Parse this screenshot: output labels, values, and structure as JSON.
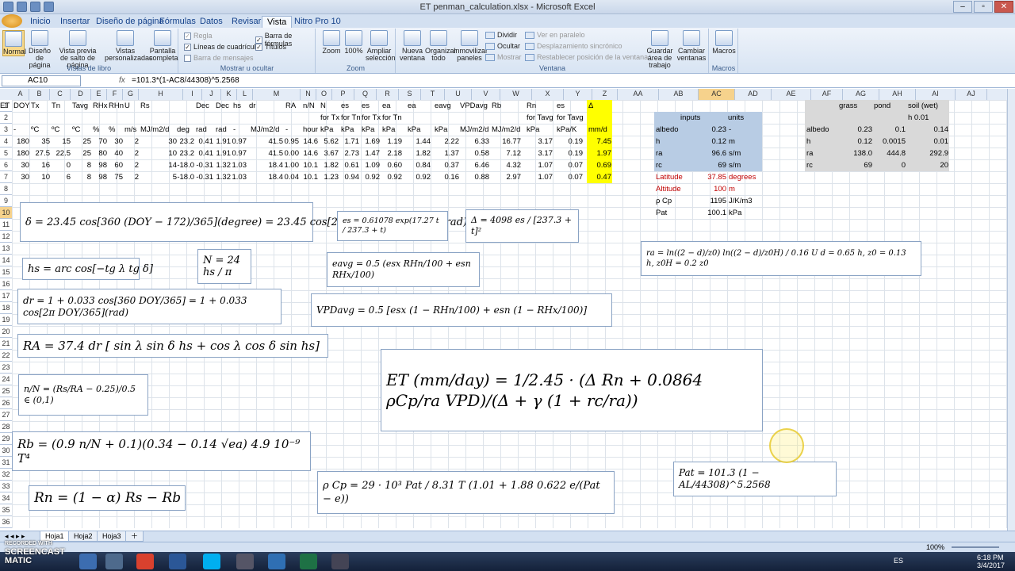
{
  "window": {
    "title": "ET penman_calculation.xlsx - Microsoft Excel"
  },
  "tabs": [
    "Inicio",
    "Insertar",
    "Diseño de página",
    "Fórmulas",
    "Datos",
    "Revisar",
    "Vista",
    "Nitro Pro 10"
  ],
  "ribbon": {
    "views": {
      "label": "Vistas de libro",
      "buttons": [
        "Normal",
        "Diseño de página",
        "Vista previa de salto de página",
        "Vistas personalizadas",
        "Pantalla completa"
      ]
    },
    "show": {
      "label": "Mostrar u ocultar",
      "items": [
        "Regla",
        "Barra de fórmulas",
        "Líneas de cuadrícula",
        "Títulos",
        "Barra de mensajes"
      ]
    },
    "zoom": {
      "label": "Zoom",
      "buttons": [
        "Zoom",
        "100%",
        "Ampliar selección"
      ]
    },
    "window": {
      "label": "Ventana",
      "buttons": [
        "Nueva ventana",
        "Organizar todo",
        "Inmovilizar paneles"
      ],
      "small": [
        "Dividir",
        "Ocultar",
        "Mostrar",
        "Ver en paralelo",
        "Desplazamiento sincrónico",
        "Restablecer posición de la ventana"
      ],
      "more": [
        "Guardar área de trabajo",
        "Cambiar ventanas"
      ]
    },
    "macros": {
      "label": "Macros",
      "button": "Macros"
    }
  },
  "formula_bar": {
    "name": "AC10",
    "fx": "fx",
    "formula": "=101.3*(1-AC8/44308)^5.2568"
  },
  "columns": [
    "A",
    "B",
    "C",
    "D",
    "E",
    "F",
    "G",
    "H",
    "I",
    "J",
    "K",
    "L",
    "M",
    "N",
    "O",
    "P",
    "Q",
    "R",
    "S",
    "T",
    "U",
    "V",
    "W",
    "X",
    "Y",
    "Z",
    "AA",
    "AB",
    "AC",
    "AD",
    "AE",
    "AF",
    "AG",
    "AH",
    "AI",
    "AJ"
  ],
  "rows": [
    "1",
    "2",
    "3",
    "4",
    "5",
    "6",
    "7",
    "8",
    "9",
    "10",
    "11",
    "12",
    "13",
    "14",
    "15",
    "16",
    "17",
    "18",
    "19",
    "20",
    "21",
    "22",
    "23",
    "24",
    "25",
    "26",
    "27",
    "28",
    "29",
    "30",
    "31",
    "32",
    "33",
    "34",
    "35",
    "36",
    "37",
    "38"
  ],
  "table": {
    "header1": [
      "DOY",
      "Tx",
      "Tn",
      "Tavg",
      "RHx",
      "RHn",
      "U",
      "Rs",
      "",
      "Dec",
      "Dec",
      "hs",
      "dr",
      "",
      "RA",
      "n/N",
      "N",
      "es",
      "es",
      "ea",
      "ea",
      "eavg",
      "VPDavg",
      "Rb",
      "Rn",
      "es",
      "Δ",
      "ET"
    ],
    "header2": [
      "for Tx",
      "for Tn",
      "for Tx",
      "for Tn",
      "for Tavg",
      "for Tavg"
    ],
    "header3": [
      "-",
      "ºC",
      "ºC",
      "ºC",
      "%",
      "%",
      "m/s",
      "MJ/m2/d",
      "deg",
      "rad",
      "rad",
      "-",
      "",
      "MJ/m2/d",
      "-",
      "hour",
      "kPa",
      "kPa",
      "kPa",
      "kPa",
      "kPa",
      "kPa",
      "MJ/m2/d",
      "MJ/m2/d",
      "kPa",
      "kPa/K",
      "mm/d"
    ],
    "rows": [
      [
        "180",
        "35",
        "15",
        "25",
        "70",
        "30",
        "2",
        "30",
        "23.2",
        "0.41",
        "1.91",
        "0.97",
        "",
        "41.5",
        "0.95",
        "14.6",
        "5.62",
        "1.71",
        "1.69",
        "1.19",
        "1.44",
        "2.22",
        "6.33",
        "16.77",
        "3.17",
        "0.19",
        "7.45"
      ],
      [
        "180",
        "27.5",
        "22.5",
        "25",
        "80",
        "40",
        "2",
        "10",
        "23.2",
        "0.41",
        "1.91",
        "0.97",
        "",
        "41.5",
        "0.00",
        "14.6",
        "3.67",
        "2.73",
        "1.47",
        "2.18",
        "1.82",
        "1.37",
        "0.58",
        "7.12",
        "3.17",
        "0.19",
        "1.97"
      ],
      [
        "30",
        "16",
        "0",
        "8",
        "98",
        "60",
        "2",
        "14",
        "-18.0",
        "-0.31",
        "1.32",
        "1.03",
        "",
        "18.4",
        "1.00",
        "10.1",
        "1.82",
        "0.61",
        "1.09",
        "0.60",
        "0.84",
        "0.37",
        "6.46",
        "4.32",
        "1.07",
        "0.07",
        "0.69"
      ],
      [
        "30",
        "10",
        "6",
        "8",
        "98",
        "75",
        "2",
        "5",
        "-18.0",
        "-0.31",
        "1.32",
        "1.03",
        "",
        "18.4",
        "0.04",
        "10.1",
        "1.23",
        "0.94",
        "0.92",
        "0.92",
        "0.92",
        "0.16",
        "0.88",
        "2.97",
        "1.07",
        "0.07",
        "0.47"
      ]
    ]
  },
  "inputs": {
    "title": "inputs",
    "units_title": "units",
    "rows": [
      {
        "label": "albedo",
        "value": "0.23",
        "unit": "-"
      },
      {
        "label": "h",
        "value": "0.12",
        "unit": "m"
      },
      {
        "label": "ra",
        "value": "96.6",
        "unit": "s/m"
      },
      {
        "label": "rc",
        "value": "69",
        "unit": "s/m"
      },
      {
        "label": "Latitude",
        "value": "37.85",
        "unit": "degrees"
      },
      {
        "label": "Altitude",
        "value": "100",
        "unit": "m"
      },
      {
        "label": "ρ Cp",
        "value": "1195",
        "unit": "J/K/m3"
      },
      {
        "label": "Pat",
        "value": "100.1",
        "unit": "kPa"
      }
    ]
  },
  "surfaces": {
    "headers": [
      "grass",
      "pond",
      "soil (wet)"
    ],
    "sub": "h 0.01",
    "rows": [
      {
        "label": "albedo",
        "values": [
          "0.23",
          "0.1",
          "0.14"
        ]
      },
      {
        "label": "h",
        "values": [
          "0.12",
          "0.0015",
          "0.01"
        ]
      },
      {
        "label": "ra",
        "values": [
          "138.0",
          "444.8",
          "292.9"
        ]
      },
      {
        "label": "rc",
        "values": [
          "69",
          "0",
          "20"
        ]
      }
    ]
  },
  "equations": {
    "dec": "δ = 23.45 cos[360 (DOY − 172)/365](degree) = 23.45 cos[2π (DOY − 172)/365](rad)",
    "es": "es = 0.61078 exp(17.27 t / 237.3 + t)",
    "delta": "Δ = 4098 es / [237.3 + t]²",
    "hs": "hs = arc cos[−tg λ tg δ]",
    "N": "N = 24 hs / π",
    "eavg": "eavg = 0.5 (esx RHn/100 + esn RHx/100)",
    "dr": "dr = 1 + 0.033 cos[360 DOY/365] = 1 + 0.033 cos[2π DOY/365](rad)",
    "vpd": "VPDavg = 0.5 [esx (1 − RHn/100) + esn (1 − RHx/100)]",
    "RA": "RA = 37.4 dr [ sin λ sin δ hs + cos λ cos δ sin hs]",
    "nN": "n/N = (Rs/RA − 0.25)/0.5 ∈ (0,1)",
    "ET": "ET (mm/day) = 1/2.45 · (Δ Rn + 0.0864 ρCp/ra VPD)/(Δ + γ (1 + rc/ra))",
    "Rb": "Rb = (0.9 n/N + 0.1)(0.34 − 0.14 √ea) 4.9 10⁻⁹ T⁴",
    "Rn": "Rn = (1 − α) Rs − Rb",
    "rhoCp": "ρ Cp = 29 · 10³ Pat / 8.31 T (1.01 + 1.88 0.622 e/(Pat − e))",
    "Pat": "Pat = 101.3 (1 − AL/44308)^5.2568",
    "ra": "ra = ln((2 − d)/z0) ln((2 − d)/z0H) / 0.16 U     d = 0.65 h,   z0 = 0.13 h,   z0H = 0.2 z0"
  },
  "sheets": [
    "Hoja1",
    "Hoja2",
    "Hoja3"
  ],
  "status": {
    "zoom": "100%"
  },
  "taskbar": {
    "time": "6:18 PM",
    "date": "3/4/2017",
    "lang": "ES"
  },
  "watermark": {
    "line1": "RECORDED WITH",
    "line2": "SCREENCAST",
    "line3": "MATIC"
  }
}
